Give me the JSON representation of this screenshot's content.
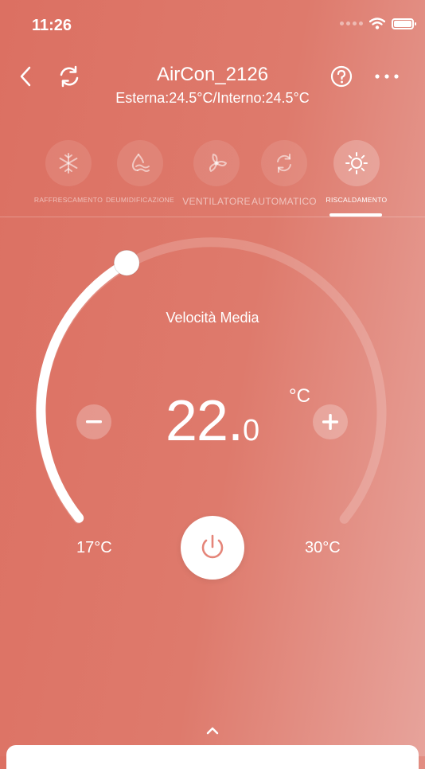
{
  "status": {
    "time": "11:26"
  },
  "header": {
    "title": "AirCon_2126",
    "subtitle": "Esterna:24.5°C/Interno:24.5°C"
  },
  "modes": [
    {
      "label": "RAFFRESCAMENTO",
      "icon": "snowflake-icon",
      "active": false
    },
    {
      "label": "DEUMIDIFICAZIONE",
      "icon": "droplet-icon",
      "active": false
    },
    {
      "label": "VENTILATORE",
      "icon": "fan-icon",
      "active": false
    },
    {
      "label": "AUTOMATICO",
      "icon": "auto-cycle-icon",
      "active": false
    },
    {
      "label": "RISCALDAMENTO",
      "icon": "sun-icon",
      "active": true
    }
  ],
  "thermostat": {
    "fan_speed": "Velocità Media",
    "temp_integer": "22.",
    "temp_decimal": "0",
    "unit": "°C",
    "min_label": "17°C",
    "max_label": "30°C",
    "min_value": 17,
    "max_value": 30,
    "setpoint": 22.0
  },
  "colors": {
    "accent": "#ffffff",
    "background_start": "#dc7062",
    "background_end": "#e7a39b",
    "power_icon": "#e58579"
  }
}
